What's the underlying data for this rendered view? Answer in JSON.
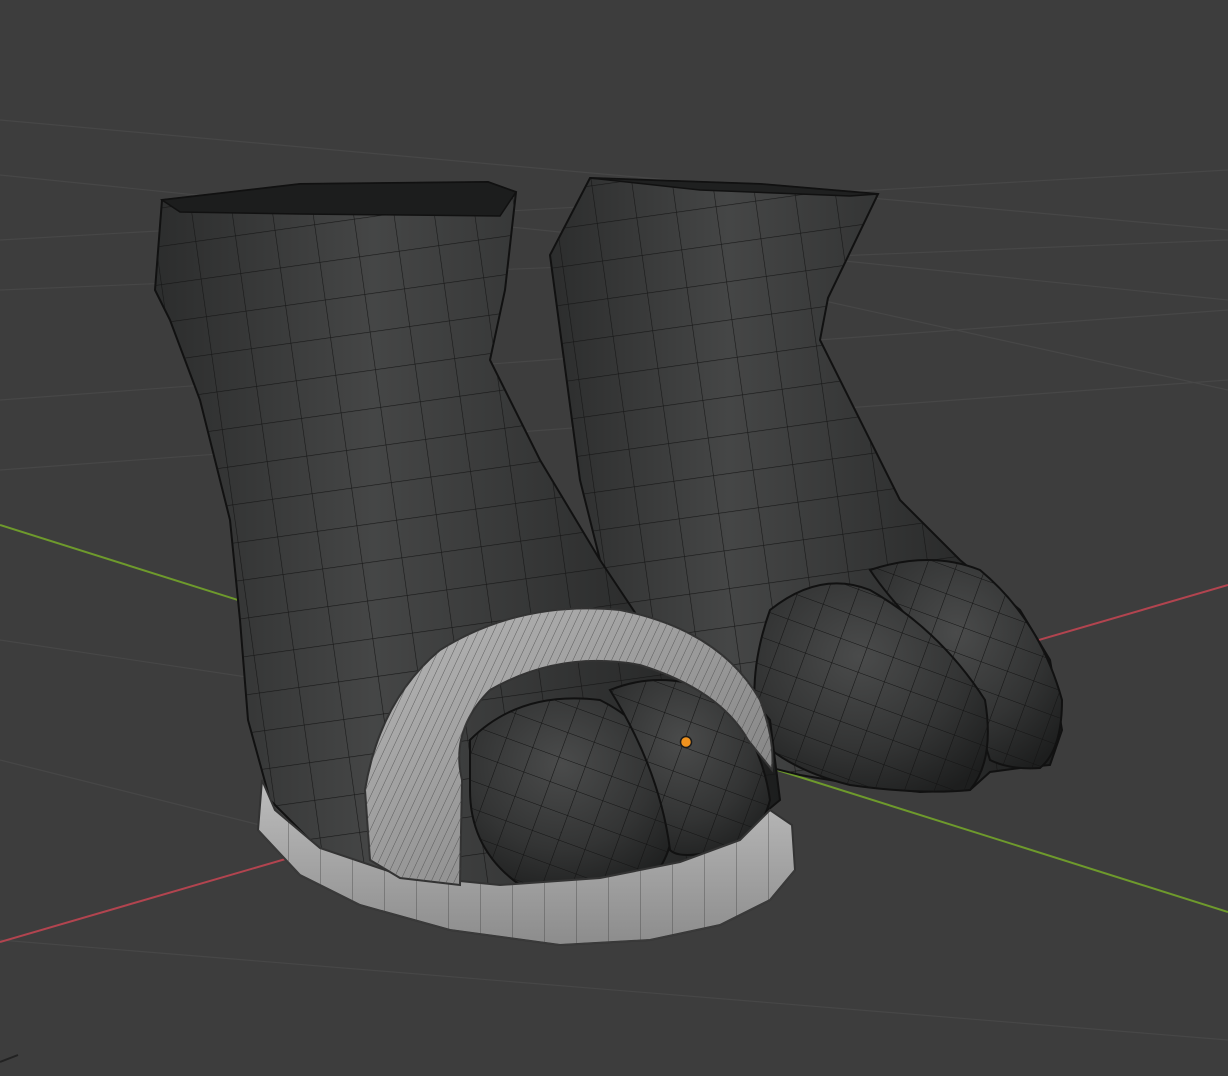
{
  "viewport": {
    "background_color": "#3d3d3d",
    "grid_color": "#474747",
    "x_axis_color": "#b2444f",
    "y_axis_color": "#6e9a2c"
  },
  "scene": {
    "objects": [
      {
        "name": "left-foot",
        "material_color": "#2f3030",
        "wire_color": "#121212"
      },
      {
        "name": "right-foot",
        "material_color": "#2f3030",
        "wire_color": "#121212"
      },
      {
        "name": "sandal-strap",
        "material_color": "#9c9c9c",
        "wire_color": "#3a3a3a"
      },
      {
        "name": "sandal-sole",
        "material_color": "#a8a8a8",
        "wire_color": "#3a3a3a"
      }
    ],
    "origin_marker_color": "#f0921e",
    "selected": false
  }
}
